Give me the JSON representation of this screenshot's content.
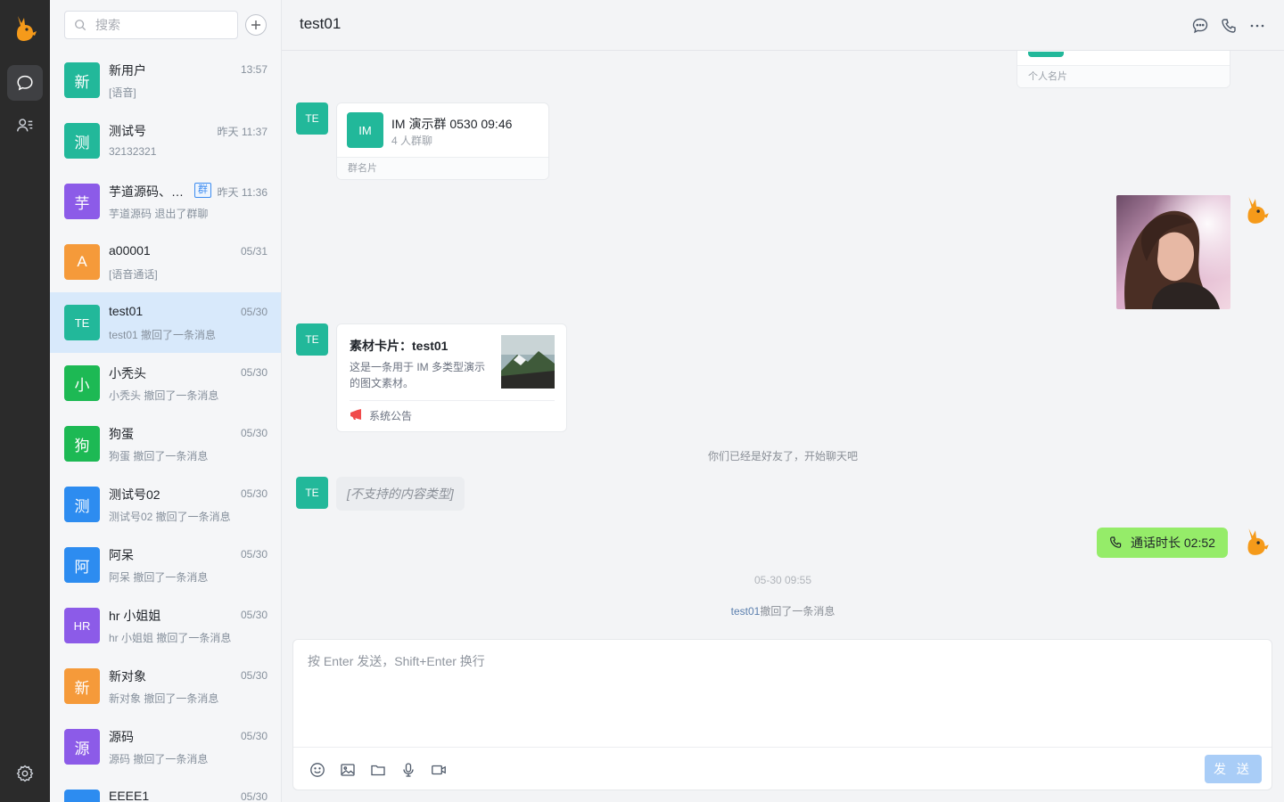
{
  "search": {
    "placeholder": "搜索"
  },
  "conversations": [
    {
      "name": "新用户",
      "time": "13:57",
      "preview": "[语音]",
      "avatar": "新",
      "color": "#22b89a"
    },
    {
      "name": "测试号",
      "time": "昨天 11:37",
      "preview": "32132321",
      "avatar": "测",
      "color": "#22b89a"
    },
    {
      "name": "芋道源码、…",
      "time": "昨天 11:36",
      "preview": "芋道源码 退出了群聊",
      "avatar": "芋",
      "color": "#8c5be8",
      "tag": "群"
    },
    {
      "name": "a00001",
      "time": "05/31",
      "preview": "[语音通话]",
      "avatar": "A",
      "color": "#f59a3a"
    },
    {
      "name": "test01",
      "time": "05/30",
      "preview": "test01 撤回了一条消息",
      "avatar": "TE",
      "color": "#22b89a"
    },
    {
      "name": "小秃头",
      "time": "05/30",
      "preview": "小秃头 撤回了一条消息",
      "avatar": "小",
      "color": "#1db954"
    },
    {
      "name": "狗蛋",
      "time": "05/30",
      "preview": "狗蛋 撤回了一条消息",
      "avatar": "狗",
      "color": "#1db954"
    },
    {
      "name": "测试号02",
      "time": "05/30",
      "preview": "测试号02 撤回了一条消息",
      "avatar": "测",
      "color": "#2d8cf0"
    },
    {
      "name": "阿呆",
      "time": "05/30",
      "preview": "阿呆 撤回了一条消息",
      "avatar": "阿",
      "color": "#2d8cf0"
    },
    {
      "name": "hr 小姐姐",
      "time": "05/30",
      "preview": "hr 小姐姐 撤回了一条消息",
      "avatar": "HR",
      "color": "#8c5be8"
    },
    {
      "name": "新对象",
      "time": "05/30",
      "preview": "新对象 撤回了一条消息",
      "avatar": "新",
      "color": "#f59a3a"
    },
    {
      "name": "源码",
      "time": "05/30",
      "preview": "源码 撤回了一条消息",
      "avatar": "源",
      "color": "#8c5be8"
    },
    {
      "name": "EEEE1",
      "time": "05/30",
      "preview": "",
      "avatar": "",
      "color": "#2d8cf0"
    }
  ],
  "chat": {
    "title": "test01",
    "peer_avatar": "TE",
    "personal_card_label": "个人名片",
    "group_card": {
      "avatar": "IM",
      "title": "IM 演示群 0530 09:46",
      "subtitle": "4 人群聊",
      "footer": "群名片"
    },
    "material_card": {
      "title": "素材卡片：test01",
      "desc": "这是一条用于 IM 多类型演示的图文素材。",
      "footer": "系统公告"
    },
    "friend_notice": "你们已经是好友了，开始聊天吧",
    "unsupported": "[不支持的内容类型]",
    "call_bubble": "通话时长 02:52",
    "timestamp": "05-30 09:55",
    "recall_name": "test01",
    "recall_text": "撤回了一条消息"
  },
  "composer": {
    "placeholder": "按 Enter 发送，Shift+Enter 换行",
    "send_label": "发 送"
  },
  "colors": {
    "accent": "#2d8cf0",
    "rail": "#2b2b2b",
    "call_bubble": "#95ec69",
    "send_disabled": "#a9cdf7"
  }
}
